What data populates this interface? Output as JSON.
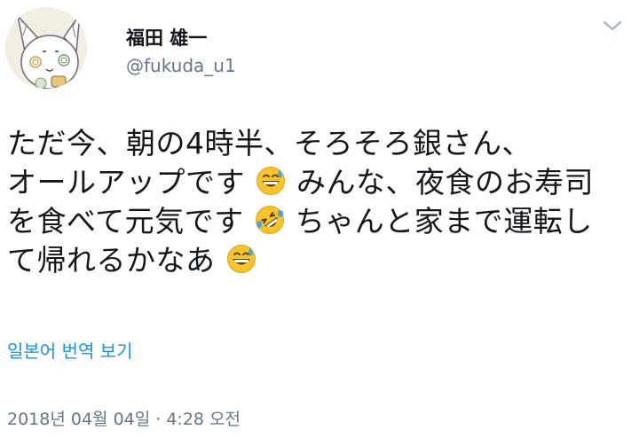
{
  "tweet": {
    "author": {
      "display_name": "福田 雄一",
      "handle": "@fukuda_u1"
    },
    "text_lines": [
      {
        "parts": [
          "ただ今、朝の4時半、そろそろ銀さん、"
        ]
      },
      {
        "parts": [
          "オールアップです",
          "みんな、夜食のお寿司"
        ]
      },
      {
        "parts": [
          "を食べて元気です",
          "ちゃんと家まで運転し"
        ]
      },
      {
        "parts": [
          "て帰れるかなあ"
        ]
      }
    ],
    "emojis": {
      "line2": "grinning-sweat-emoji",
      "line3": "rolling-on-floor-laughing-emoji",
      "line4": "grinning-sweat-emoji"
    },
    "translate_link": "일본어 번역 보기",
    "timestamp": "2018년 04월 04일 · 4:28 오전"
  },
  "colors": {
    "text": "#14171a",
    "secondary": "#657786",
    "link": "#1b95e0"
  },
  "icons": {
    "menu": "chevron-down-icon",
    "avatar": "cat-drawing-avatar"
  }
}
